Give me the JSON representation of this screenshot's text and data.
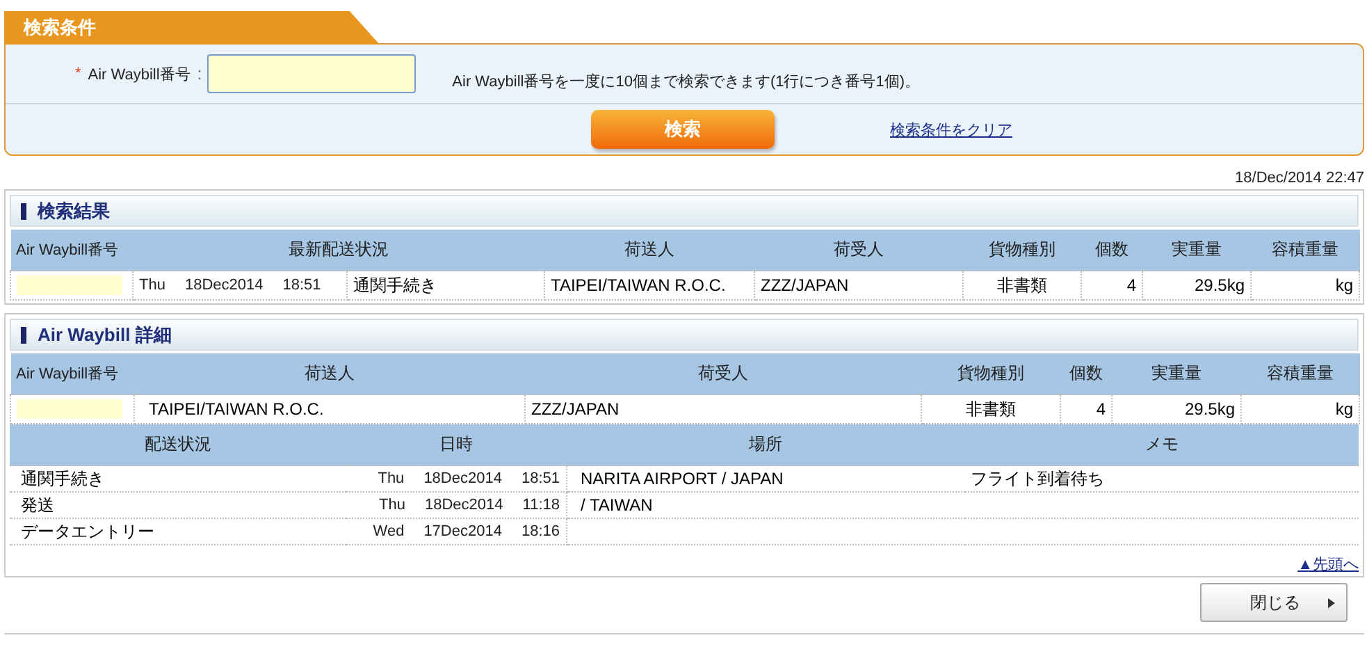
{
  "search_panel": {
    "tab_title": "検索条件",
    "field": {
      "required_mark": "*",
      "label": "Air Waybill番号",
      "separator": ":",
      "hint": "Air Waybill番号を一度に10個まで検索できます(1行につき番号1個)。"
    },
    "search_button": "検索",
    "clear_link": "検索条件をクリア"
  },
  "timestamp": "18/Dec/2014 22:47",
  "results": {
    "title": "検索結果",
    "columns": [
      "Air Waybill番号",
      "最新配送状況",
      "荷送人",
      "荷受人",
      "貨物種別",
      "個数",
      "実重量",
      "容積重量"
    ],
    "rows": [
      {
        "day": "Thu",
        "date": "18Dec2014",
        "time": "18:51",
        "status": "通関手続き",
        "shipper": "TAIPEI/TAIWAN R.O.C.",
        "consignee": "ZZZ/JAPAN",
        "cargo_type": "非書類",
        "pieces": "4",
        "actual_weight": "29.5kg",
        "volume_weight": "kg"
      }
    ]
  },
  "detail": {
    "title": "Air Waybill 詳細",
    "columns": [
      "Air Waybill番号",
      "荷送人",
      "荷受人",
      "貨物種別",
      "個数",
      "実重量",
      "容積重量"
    ],
    "row": {
      "shipper": "TAIPEI/TAIWAN R.O.C.",
      "consignee": "ZZZ/JAPAN",
      "cargo_type": "非書類",
      "pieces": "4",
      "actual_weight": "29.5kg",
      "volume_weight": "kg"
    },
    "history_columns": [
      "配送状況",
      "日時",
      "場所",
      "メモ"
    ],
    "history": [
      {
        "status": "通関手続き",
        "day": "Thu",
        "date": "18Dec2014",
        "time": "18:51",
        "location": "NARITA AIRPORT / JAPAN",
        "memo": "フライト到着待ち"
      },
      {
        "status": "発送",
        "day": "Thu",
        "date": "18Dec2014",
        "time": "11:18",
        "location": " / TAIWAN"
      },
      {
        "status": "データエントリー",
        "day": "Wed",
        "date": "17Dec2014",
        "time": "18:16"
      }
    ],
    "top_link": "▲先頭へ"
  },
  "close_button": "閉じる"
}
